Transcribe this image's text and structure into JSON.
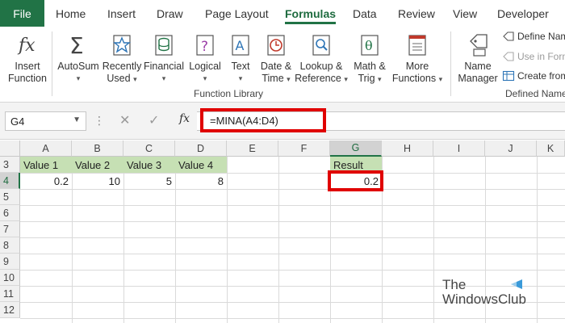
{
  "menu": {
    "tabs": [
      "File",
      "Home",
      "Insert",
      "Draw",
      "Page Layout",
      "Formulas",
      "Data",
      "Review",
      "View",
      "Developer"
    ],
    "active": "Formulas"
  },
  "ribbon": {
    "insert_function": [
      "Insert",
      "Function"
    ],
    "autosum": "AutoSum",
    "recently_used": [
      "Recently",
      "Used"
    ],
    "financial": "Financial",
    "logical": "Logical",
    "text": "Text",
    "date_time": [
      "Date &",
      "Time"
    ],
    "lookup_reference": [
      "Lookup &",
      "Reference"
    ],
    "math_trig": [
      "Math &",
      "Trig"
    ],
    "more_functions": [
      "More",
      "Functions"
    ],
    "function_library_label": "Function Library",
    "name_manager": [
      "Name",
      "Manager"
    ],
    "define_name": "Define Nam",
    "use_in_formula": "Use in Form",
    "create_from": "Create from",
    "defined_names_label": "Defined Names"
  },
  "formula_bar": {
    "name_box": "G4",
    "fx": "fx",
    "formula": "=MINA(A4:D4)"
  },
  "grid": {
    "columns": [
      "A",
      "B",
      "C",
      "D",
      "E",
      "F",
      "G",
      "H",
      "I",
      "J",
      "K"
    ],
    "selected_column": "G",
    "rows": [
      "3",
      "4",
      "5",
      "6",
      "7",
      "8",
      "9",
      "10",
      "11",
      "12"
    ],
    "selected_row": "4",
    "headers": [
      "Value 1",
      "Value 2",
      "Value 3",
      "Value 4"
    ],
    "values": [
      "0.2",
      "10",
      "5",
      "8"
    ],
    "result_header": "Result",
    "result_value": "0.2"
  },
  "watermark": {
    "line1": "The",
    "line2": "WindowsClub"
  },
  "colors": {
    "excel_green": "#217346",
    "header_fill": "#c6e0b4",
    "highlight_red": "#e00000"
  }
}
